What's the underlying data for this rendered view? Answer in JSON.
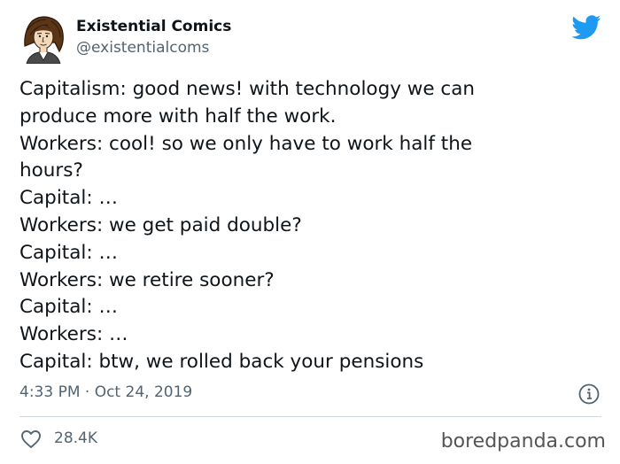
{
  "account": {
    "display_name": "Existential Comics",
    "handle": "@existentialcoms",
    "avatar_icon": "cartoon-portrait-avatar"
  },
  "brand": {
    "icon": "twitter-bird-icon",
    "accent_color": "#1d9bf0"
  },
  "tweet": {
    "lines": [
      "Capitalism: good news! with technology we can",
      "produce more with half the work.",
      "Workers: cool! so we only have to work half the",
      "hours?",
      "Capital: …",
      "Workers: we get paid double?",
      "Capital: …",
      "Workers: we retire sooner?",
      "Capital: …",
      "Workers: …",
      "Capital: btw, we rolled back your pensions"
    ],
    "timestamp": "4:33 PM · Oct 24, 2019"
  },
  "actions": {
    "likes": "28.4K",
    "like_icon": "heart-outline-icon",
    "info_icon": "info-circle-icon"
  },
  "watermark": "boredpanda.com",
  "colors": {
    "text": "#0f1419",
    "secondary_text": "#536471",
    "divider": "#cfd9de"
  }
}
